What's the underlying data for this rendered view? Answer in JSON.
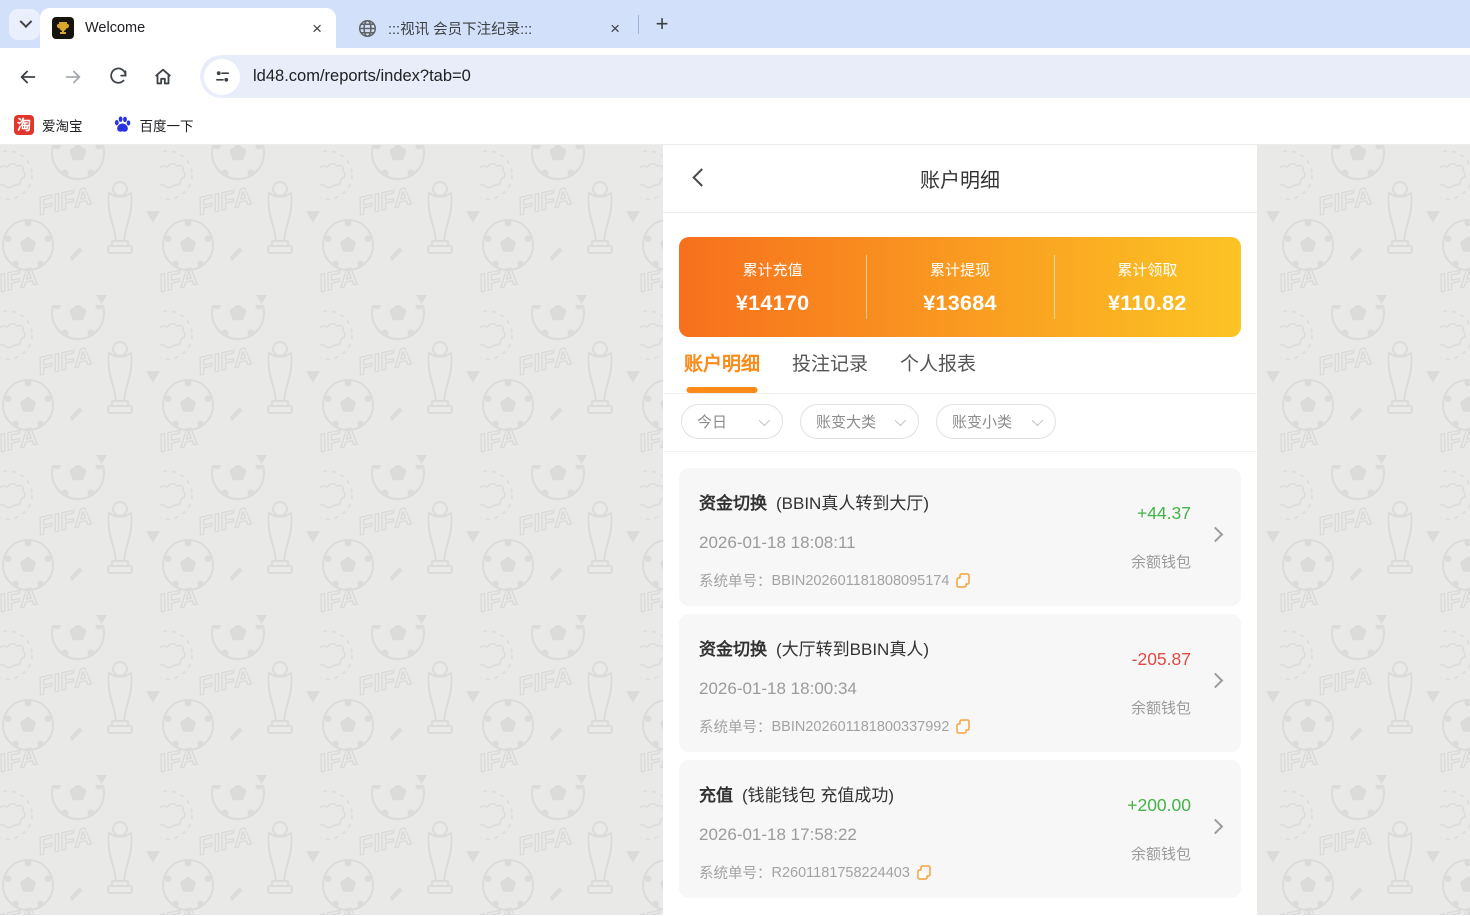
{
  "browser": {
    "tabs": [
      {
        "title": "Welcome"
      },
      {
        "title": ":::视讯 会员下注纪录:::"
      }
    ],
    "icons": {
      "close": "×",
      "new_tab": "+",
      "taobao_glyph": "淘"
    },
    "url": "ld48.com/reports/index?tab=0",
    "bookmarks": [
      {
        "label": "爱淘宝"
      },
      {
        "label": "百度一下"
      }
    ]
  },
  "page": {
    "header": {
      "title": "账户明细"
    },
    "summary": [
      {
        "label": "累计充值",
        "value": "¥14170"
      },
      {
        "label": "累计提现",
        "value": "¥13684"
      },
      {
        "label": "累计领取",
        "value": "¥110.82"
      }
    ],
    "tabs": [
      {
        "label": "账户明细",
        "active": true
      },
      {
        "label": "投注记录",
        "active": false
      },
      {
        "label": "个人报表",
        "active": false
      }
    ],
    "filters": [
      {
        "label": "今日"
      },
      {
        "label": "账变大类"
      },
      {
        "label": "账变小类"
      }
    ],
    "order_label": "系统单号：",
    "records": [
      {
        "type": "资金切换",
        "detail": "(BBIN真人转到大厅)",
        "time": "2026-01-18 18:08:11",
        "order_no": "BBIN202601181808095174",
        "amount": "+44.37",
        "direction": "positive",
        "wallet": "余额钱包"
      },
      {
        "type": "资金切换",
        "detail": "(大厅转到BBIN真人)",
        "time": "2026-01-18 18:00:34",
        "order_no": "BBIN202601181800337992",
        "amount": "-205.87",
        "direction": "negative",
        "wallet": "余额钱包"
      },
      {
        "type": "充值",
        "detail": "(钱能钱包 充值成功)",
        "time": "2026-01-18 17:58:22",
        "order_no": "R2601181758224403",
        "amount": "+200.00",
        "direction": "positive",
        "wallet": "余额钱包"
      }
    ],
    "colors": {
      "accent_orange": "#fb8a19",
      "summary_gradient_start": "#f7701d",
      "summary_gradient_end": "#fcc424",
      "amount_positive": "#44b244",
      "amount_negative": "#e34a42"
    }
  }
}
